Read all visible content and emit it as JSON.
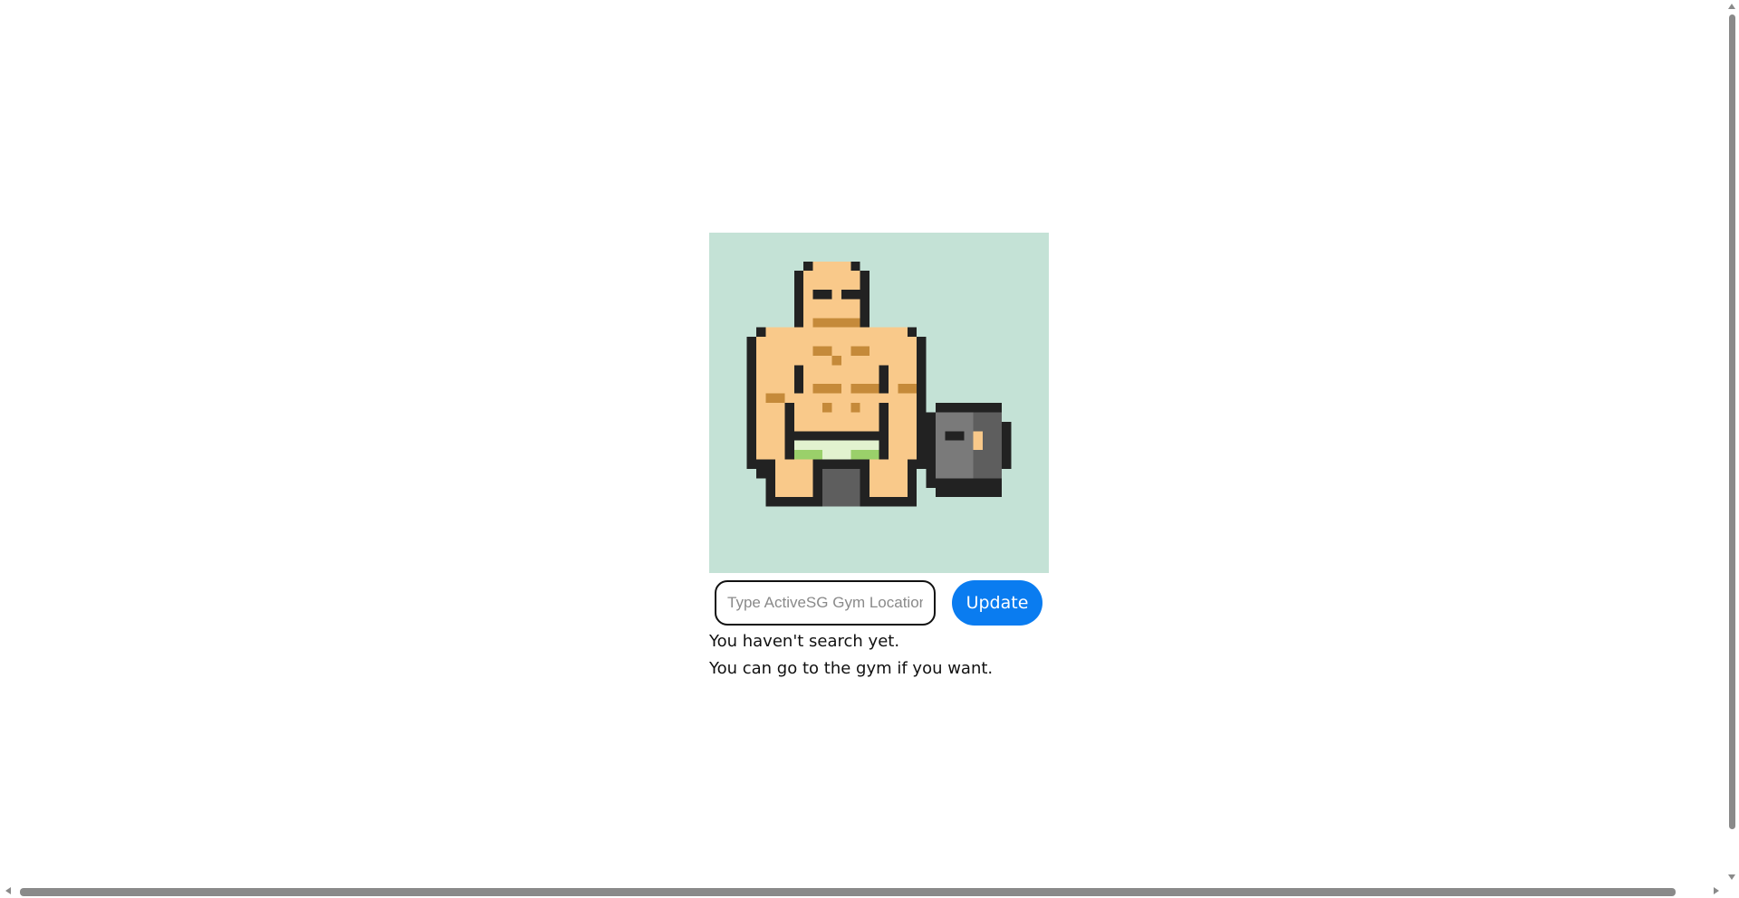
{
  "hero": {
    "icon": "muscle-man-dumbbell-pixel-art",
    "background_color": "#c4e2d6"
  },
  "search": {
    "placeholder": "Type ActiveSG Gym Location",
    "value": ""
  },
  "update_button": {
    "label": "Update",
    "color": "#0a7cf0"
  },
  "status": {
    "line1": "You haven't search yet.",
    "line2": "You can go to the gym if you want."
  }
}
